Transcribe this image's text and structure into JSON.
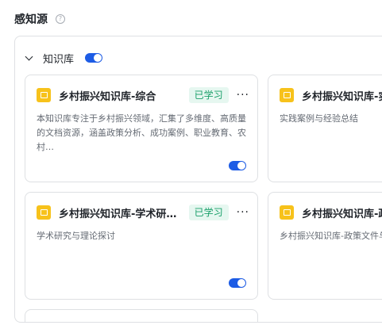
{
  "section": {
    "title": "感知源",
    "help_icon": "question-circle-icon"
  },
  "group": {
    "title": "知识库",
    "enabled": true
  },
  "cards": [
    {
      "title": "乡村振兴知识库-综合",
      "badge": "已学习",
      "description": "本知识库专注于乡村振兴领域，汇集了多维度、高质量的文档资源，涵盖政策分析、成功案例、职业教育、农村…",
      "enabled": true
    },
    {
      "title": "乡村振兴知识库-实践案例",
      "badge": "",
      "description": "实践案例与经验总结",
      "enabled": true
    },
    {
      "title": "乡村振兴知识库-学术研究…",
      "badge": "已学习",
      "description": "学术研究与理论探讨",
      "enabled": true
    },
    {
      "title": "乡村振兴知识库-政策文件",
      "badge": "",
      "description": "乡村振兴知识库-政策文件与",
      "enabled": true
    }
  ],
  "colors": {
    "accent": "#1d5ce5",
    "badge_bg": "#e6f7f0",
    "badge_text": "#1aa06a",
    "icon": "#f7c21b"
  }
}
